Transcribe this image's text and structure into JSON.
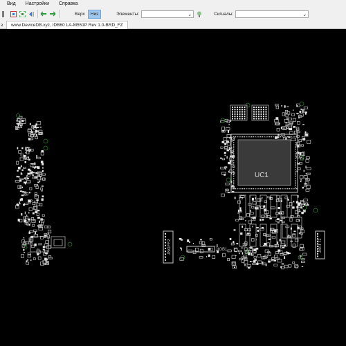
{
  "menu": {
    "items": [
      "Вид",
      "Настройки",
      "Справка"
    ]
  },
  "toolbar": {
    "side_top": "Верх",
    "side_bottom": "Низ",
    "active_side": "Низ",
    "elements_label": "Элементы:",
    "elements_value": "",
    "signals_label": "Сигналы:",
    "signals_value": ""
  },
  "tabs": {
    "partial_label": "з",
    "active_label": "www.DeviceDB.xyz, IDB60 LA-M551P Rev 1.0-BRD_FZ"
  },
  "board": {
    "cpu_label": "UC1",
    "connector_left_label": "JNGFF2",
    "connector_mid_label": "JIOB1",
    "connector_right_label": "JBATT1",
    "outline_color": "#c8c8c8",
    "pad_color": "#e6e6e6",
    "accent_color": "#2f7a2f"
  }
}
